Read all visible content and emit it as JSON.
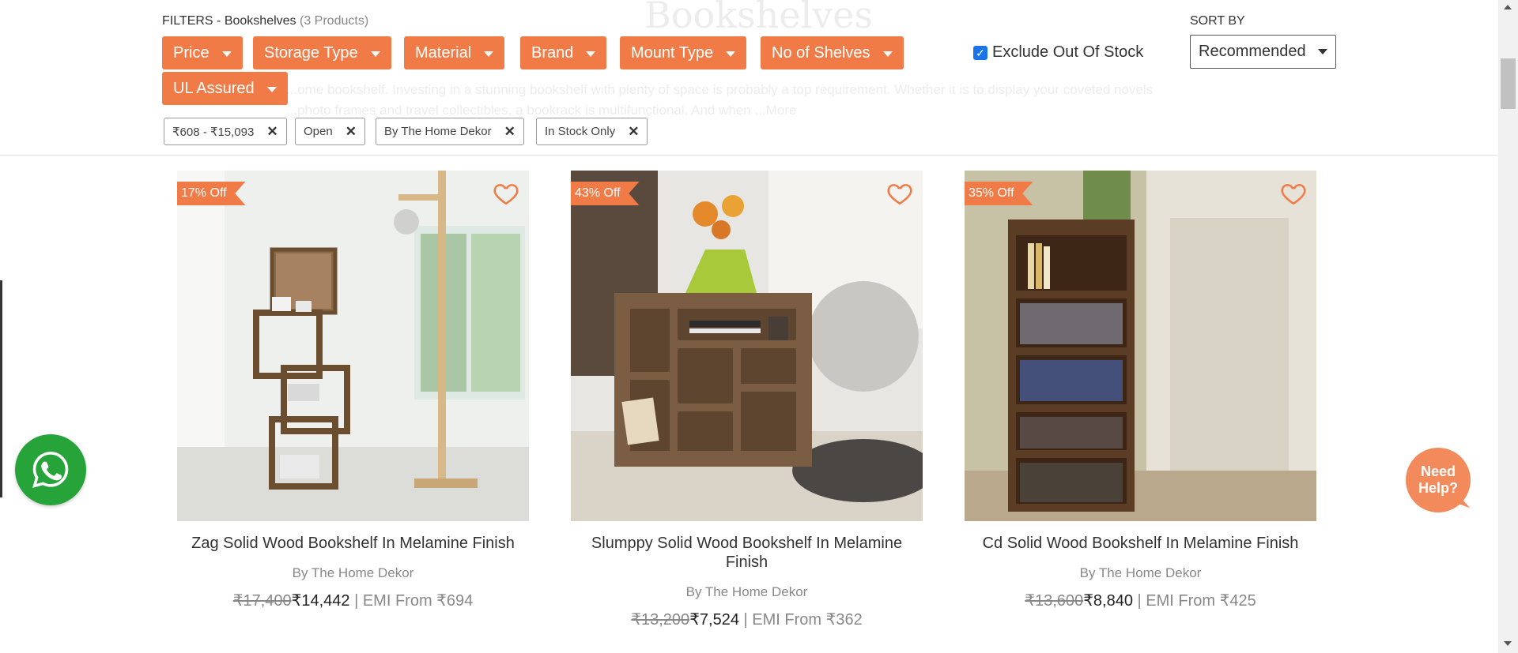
{
  "background": {
    "title": "Bookshelves",
    "desc_line1": "...ome bookshelf. Investing in a stunning bookshelf with plenty of space is probably a top requirement. Whether it is to display your coveted novels",
    "desc_line2": "...photo frames and travel collectibles, a bookrack is multifunctional. And when ...More"
  },
  "filters": {
    "label": "FILTERS - Bookshelves",
    "count": "(3 Products)",
    "buttons": [
      "Price",
      "Storage Type",
      "Material",
      "Brand",
      "Mount Type",
      "No of Shelves",
      "UL Assured"
    ],
    "exclude_label": "Exclude Out Of Stock",
    "exclude_checked": true,
    "applied": [
      "₹608 - ₹15,093",
      "Open",
      "By The Home Dekor",
      "In Stock Only"
    ]
  },
  "sort": {
    "label": "SORT BY",
    "selected": "Recommended"
  },
  "products": [
    {
      "badge": "17% Off",
      "name": "Zag Solid Wood Bookshelf In Melamine Finish",
      "brand": "By The Home Dekor",
      "mrp": "₹17,400",
      "price": "₹14,442",
      "emi": "| EMI From ₹694"
    },
    {
      "badge": "43% Off",
      "name": "Slumppy Solid Wood Bookshelf In Melamine Finish",
      "brand": "By The Home Dekor",
      "mrp": "₹13,200",
      "price": "₹7,524",
      "emi": "| EMI From ₹362"
    },
    {
      "badge": "35% Off",
      "name": "Cd Solid Wood Bookshelf In Melamine Finish",
      "brand": "By The Home Dekor",
      "mrp": "₹13,600",
      "price": "₹8,840",
      "emi": "| EMI From ₹425"
    }
  ],
  "help": {
    "line1": "Need",
    "line2": "Help?"
  },
  "icons": {
    "whatsapp": "whatsapp-icon",
    "wishlist": "heart-icon",
    "remove": "close-icon",
    "dropdown": "chevron-down-icon"
  },
  "colors": {
    "accent": "#f07b47",
    "whatsapp": "#26a339",
    "help": "#f38a5c"
  }
}
